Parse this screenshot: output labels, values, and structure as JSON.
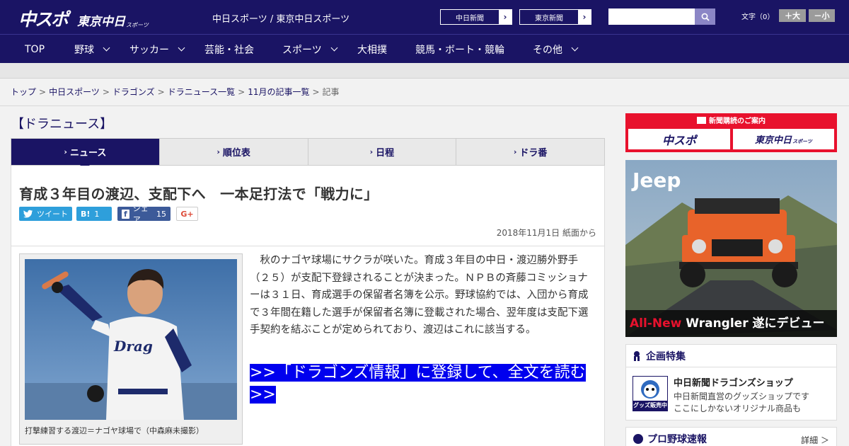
{
  "header": {
    "logo_chuspo": "中スポ",
    "logo_tokyo": "東京中日",
    "logo_sports": "スポーツ",
    "site_name": "中日スポーツ / 東京中日スポーツ",
    "link1": "中日新聞",
    "link2": "東京新聞",
    "fontsize_label": "文字（0）",
    "font_plus": "＋大",
    "font_minus": "－小"
  },
  "nav": [
    "TOP",
    "野球",
    "サッカー",
    "芸能・社会",
    "スポーツ",
    "大相撲",
    "競馬・ボート・競輪",
    "その他"
  ],
  "breadcrumb": {
    "items": [
      "トップ",
      "中日スポーツ",
      "ドラゴンズ",
      "ドラニュース一覧",
      "11月の記事一覧"
    ],
    "current": "記事"
  },
  "section_title": "【ドラニュース】",
  "tabs": [
    "ニュース",
    "順位表",
    "日程",
    "ドラ番"
  ],
  "article": {
    "headline": "育成３年目の渡辺、支配下へ　一本足打法で「戦力に」",
    "share_tweet": "ツイート",
    "share_hatena_icon": "B!",
    "share_hatena_count": "1",
    "share_fb": "シェア",
    "share_fb_count": "15",
    "share_gplus": "G+",
    "date": "2018年11月1日 紙面から",
    "photo_caption": "打撃練習する渡辺＝ナゴヤ球場で（中森麻未撮影）",
    "body": "　秋のナゴヤ球場にサクラが咲いた。育成３年目の中日・渡辺勝外野手（２５）が支配下登録されることが決まった。ＮＰＢの斉藤コミッショナーは３１日、育成選手の保留者名簿を公示。野球協約では、入団から育成で３年間在籍した選手が保留者名簿に登載された場合、翌年度は支配下選手契約を結ぶことが定められており、渡辺はこれに該当する。",
    "cta": ">>「ドラゴンズ情報」に登録して、全文を読む >>"
  },
  "sidebar": {
    "subs_title": "新聞購読のご案内",
    "subs_btn1": "中スポ",
    "subs_btn2": "東京中日",
    "subs_btn2_small": "スポーツ",
    "ad_brand": "Jeep",
    "ad_tag_new": "All-New",
    "ad_tag_rest": " Wrangler 遂にデビュー",
    "feature_title": "企画特集",
    "shop_title": "中日新聞ドラゴンズショップ",
    "shop_line1": "中日新聞直営のグッズショップです",
    "shop_line2": "ここにしかないオリジナル商品も",
    "shop_badge": "グッズ販売中",
    "pro_title": "プロ野球速報",
    "pro_more": "詳細 ＞"
  },
  "colors": {
    "header_bg": "#1a1464",
    "cta_bg": "#0000ee",
    "subs_bg": "#e8112d"
  }
}
